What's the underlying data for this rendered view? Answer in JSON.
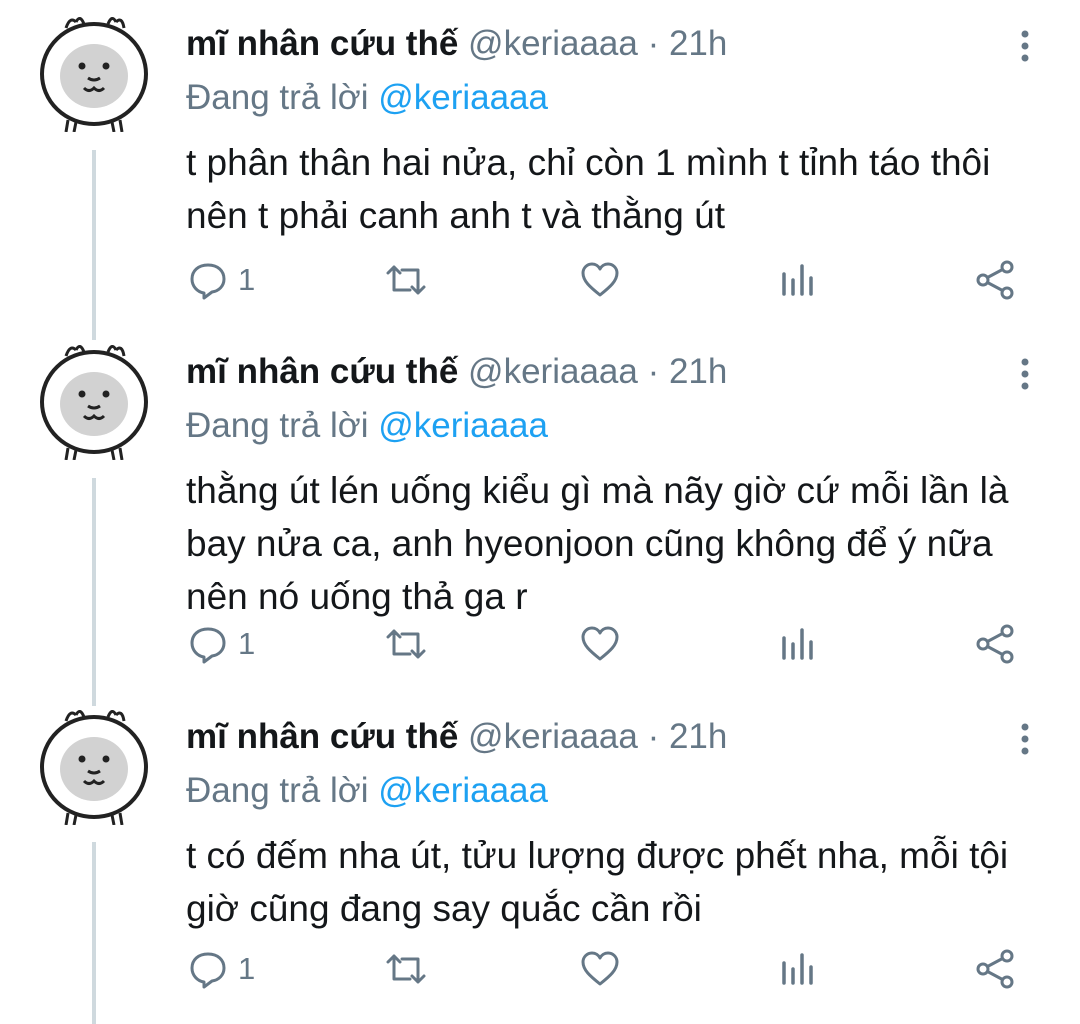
{
  "tweets": [
    {
      "name": "mĩ nhân cứu thế",
      "handle": "@keriaaaa",
      "dot": "·",
      "time": "21h",
      "reply_prefix": "Đang trả lời",
      "reply_mention": "@keriaaaa",
      "text": "t phân thân hai nửa, chỉ còn 1 mình t tỉnh táo thôi nên t phải canh anh t và thằng út",
      "reply_count": "1"
    },
    {
      "name": "mĩ nhân cứu thế",
      "handle": "@keriaaaa",
      "dot": "·",
      "time": "21h",
      "reply_prefix": "Đang trả lời",
      "reply_mention": "@keriaaaa",
      "text": "thằng út lén uống kiểu gì mà nãy giờ cứ mỗi lần là bay nửa ca, anh hyeonjoon cũng không để ý nữa nên nó uống thả ga r",
      "reply_count": "1"
    },
    {
      "name": "mĩ nhân cứu thế",
      "handle": "@keriaaaa",
      "dot": "·",
      "time": "21h",
      "reply_prefix": "Đang trả lời",
      "reply_mention": "@keriaaaa",
      "text": "t có đếm nha út, tửu lượng được phết nha, mỗi tội giờ cũng đang say quắc cần rồi",
      "reply_count": "1"
    }
  ],
  "icons": {
    "reply": "reply-icon",
    "retweet": "retweet-icon",
    "like": "heart-icon",
    "analytics": "analytics-icon",
    "share": "share-icon",
    "more": "more-vertical-icon",
    "avatar": "dog-avatar-icon"
  },
  "colors": {
    "text": "#14171a",
    "secondary": "#657786",
    "link": "#1da1f2",
    "thread_line": "#cfd9de"
  }
}
